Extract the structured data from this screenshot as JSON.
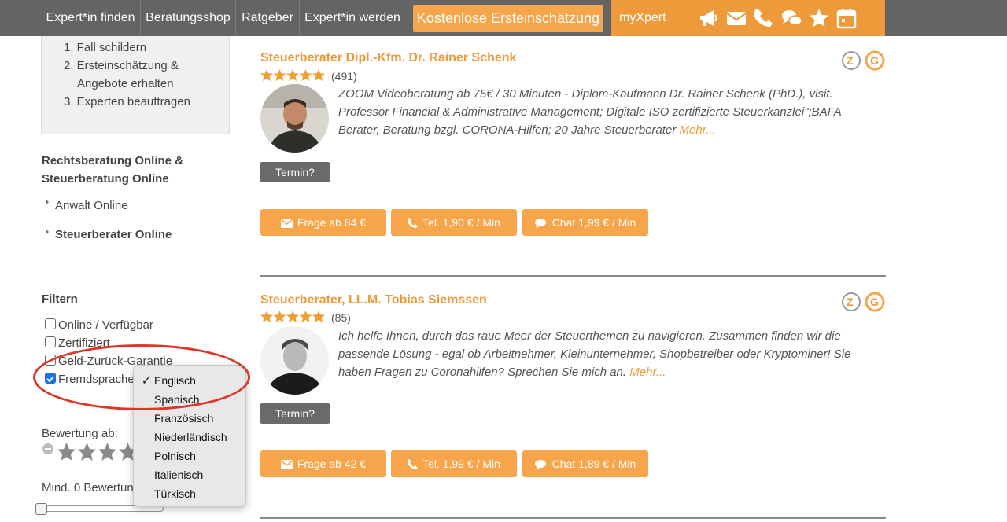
{
  "nav": {
    "items": [
      "Expert*in finden",
      "Beratungsshop",
      "Ratgeber",
      "Expert*in werden"
    ],
    "cta_label": "Kostenlose Ersteinschätzung",
    "myxpert_label": "myXpert",
    "icons": [
      "megaphone-icon",
      "envelope-icon",
      "phone-icon",
      "chat-icon",
      "star-icon",
      "calendar-icon"
    ]
  },
  "sidebar": {
    "steps": [
      "1. Fall schildern",
      "2. Ersteinschätzung &",
      "Angebote erhalten",
      "3. Experten beauftragen"
    ],
    "section_title_line1": "Rechtsberatung Online &",
    "section_title_line2": "Steuerberatung Online",
    "links": [
      "Anwalt Online",
      "Steuerberater Online"
    ],
    "filter_title": "Filtern",
    "filters": [
      {
        "label": "Online / Verfügbar",
        "checked": false
      },
      {
        "label": "Zertifiziert",
        "checked": false
      },
      {
        "label": "Geld-Zurück-Garantie",
        "checked": false
      },
      {
        "label": "Fremdsprache",
        "checked": true
      }
    ],
    "rating_label": "Bewertung ab:",
    "min_reviews_label": "Mind. 0 Bewertun"
  },
  "language_dropdown": {
    "selected": "Englisch",
    "options": [
      "Englisch",
      "Spanisch",
      "Französisch",
      "Niederländisch",
      "Polnisch",
      "Italienisch",
      "Türkisch"
    ]
  },
  "experts": [
    {
      "name": "Steuerberater Dipl.-Kfm. Dr. Rainer Schenk",
      "rating": 5,
      "count": "(491)",
      "description": "ZOOM Videoberatung ab 75€ / 30 Minuten - Diplom-Kaufmann Dr. Rainer Schenk (PhD.), visit. Professor Financial & Administrative Management; Digitale ISO zertifizierte Steuerkanzlei\";BAFA Berater, Beratung bzgl. CORONA-Hilfen; 20 Jahre Steuerberater",
      "more": "Mehr...",
      "termin": "Termin?",
      "question_btn": "Frage ab 84 €",
      "phone_btn": "Tel. 1,90 € / Min",
      "chat_btn": "Chat 1,99 € / Min"
    },
    {
      "name": "Steuerberater, LL.M. Tobias Siemssen",
      "rating": 5,
      "count": "(85)",
      "description": "Ich helfe Ihnen, durch das raue Meer der Steuerthemen zu navigieren. Zusammen finden wir die passende Lösung - egal ob Arbeitnehmer, Kleinunternehmer, Shopbetreiber oder Kryptominer! Sie haben Fragen zu Coronahilfen? Sprechen Sie mich an.",
      "more": "Mehr...",
      "termin": "Termin?",
      "question_btn": "Frage ab 42 €",
      "phone_btn": "Tel. 1,99 € / Min",
      "chat_btn": "Chat 1,89 € / Min"
    }
  ],
  "colors": {
    "accent": "#ee9a3a",
    "button": "#f6a54a",
    "nav_bg": "#646464",
    "annotation": "#e03428",
    "checkbox": "#1a73e8"
  }
}
